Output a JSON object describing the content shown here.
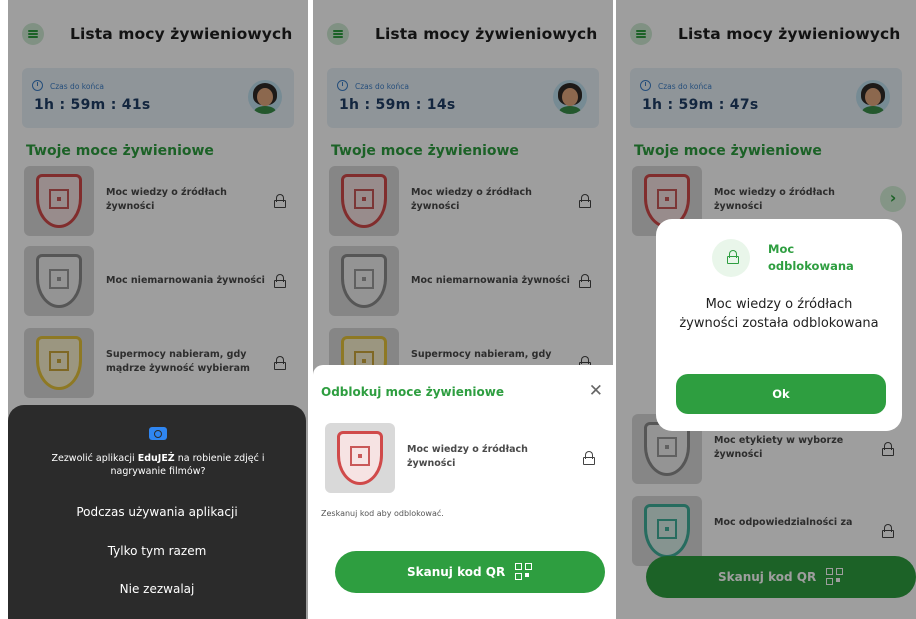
{
  "app": {
    "title": "Lista mocy żywieniowych",
    "timer_label": "Czas do końca",
    "section_title": "Twoje moce żywieniowe"
  },
  "screens": [
    {
      "timer": "1h : 59m : 41s",
      "items": [
        {
          "label": "Moc wiedzy o źródłach żywności",
          "color": "red"
        },
        {
          "label": "Moc niemarnowania żywności",
          "color": "gray"
        },
        {
          "label": "Supermocy nabieram, gdy mądrze żywność wybieram",
          "color": "yellow"
        }
      ],
      "permission": {
        "text_prefix": "Zezwolić aplikacji ",
        "app_name": "EduJEŻ",
        "text_suffix": " na robienie zdjęć i nagrywanie filmów?",
        "options": [
          "Podczas używania aplikacji",
          "Tylko tym razem",
          "Nie zezwalaj"
        ]
      }
    },
    {
      "timer": "1h : 59m : 14s",
      "items": [
        {
          "label": "Moc wiedzy o źródłach żywności",
          "color": "red"
        },
        {
          "label": "Moc niemarnowania żywności",
          "color": "gray"
        },
        {
          "label": "Supermocy nabieram, gdy",
          "color": "yellow"
        }
      ],
      "sheet": {
        "title": "Odblokuj moce żywieniowe",
        "item_label": "Moc wiedzy o źródłach żywności",
        "hint": "Zeskanuj kod aby odblokować.",
        "button": "Skanuj kod QR"
      }
    },
    {
      "timer": "1h : 59m : 47s",
      "items": [
        {
          "label": "Moc wiedzy o źródłach żywności",
          "color": "red"
        },
        {
          "label": "Moc etykiety w wyborze żywności",
          "color": "gray"
        },
        {
          "label": "Moc odpowiedzialności za",
          "color": "teal"
        }
      ],
      "modal": {
        "heading": "Moc odblokowana",
        "message": "Moc wiedzy o źródłach żywności została odblokowana",
        "ok": "Ok"
      },
      "button": "Skanuj kod QR"
    }
  ],
  "colors": {
    "accent": "#2e9e40",
    "timer_bg": "#e7f1f7",
    "dialog_bg": "#2b2b2b"
  }
}
